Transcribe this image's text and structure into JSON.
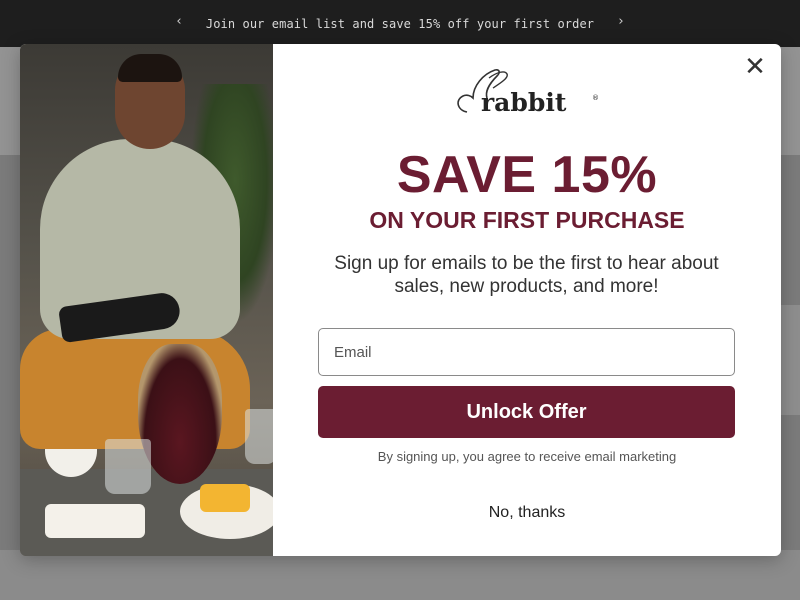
{
  "announcement": {
    "text": "Join our email list and save 15% off your first order",
    "prev_icon": "chevron-left-icon",
    "next_icon": "chevron-right-icon",
    "prev_glyph": "‹",
    "next_glyph": "›"
  },
  "popup": {
    "logo_text": "rabbit",
    "logo_mark": "®",
    "headline": "SAVE 15%",
    "subheadline": "ON YOUR FIRST PURCHASE",
    "description": "Sign up for emails to be the first to hear about sales, new products, and more!",
    "email_placeholder": "Email",
    "email_value": "",
    "submit_label": "Unlock Offer",
    "legal_text": "By signing up, you agree to receive email marketing",
    "dismiss_label": "No, thanks",
    "close_glyph": "✕",
    "close_icon": "close-icon"
  },
  "colors": {
    "brand": "#6b1d32",
    "announcement_bg": "#1e1e1e"
  }
}
